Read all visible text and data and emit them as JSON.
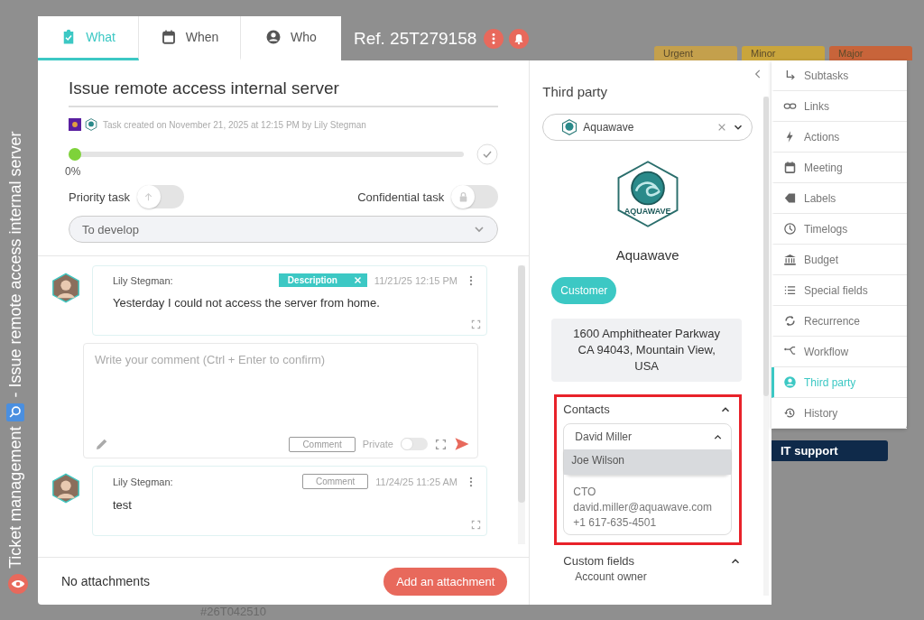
{
  "background": {
    "vertical_title": [
      "Ticket management",
      "- Issue remote access internal server"
    ],
    "priority_tags": [
      {
        "label": "Urgent",
        "color": "#c4a04c"
      },
      {
        "label": "Minor",
        "color": "#c9a53c"
      },
      {
        "label": "Major",
        "color": "#c8643a"
      }
    ],
    "team_tag": "IT support",
    "ref_below": "#26T042510"
  },
  "tabs": [
    {
      "label": "What",
      "selected": true
    },
    {
      "label": "When",
      "selected": false
    },
    {
      "label": "Who",
      "selected": false
    }
  ],
  "reference": "Ref. 25T279158",
  "task": {
    "title": "Issue remote access internal server",
    "meta": "Task created on November 21, 2025 at 12:15 PM by Lily Stegman",
    "progress": {
      "level": 0,
      "reading": "0%"
    },
    "toggles": [
      {
        "label": "Priority task",
        "on": false
      },
      {
        "label": "Confidential task",
        "on": false
      }
    ],
    "status": "To develop"
  },
  "comments": [
    {
      "kind": "description",
      "author": "Lily Stegman:",
      "tag": "Description",
      "time": "11/21/25 12:15 PM",
      "text": "Yesterday I could not access the server from home."
    },
    {
      "kind": "comment",
      "author": "Lily Stegman:",
      "tag": "Comment",
      "time": "11/24/25 11:25 AM",
      "text": "test"
    }
  ],
  "composer": {
    "placeholder": "Write your comment (Ctrl + Enter to confirm)",
    "type_label": "Comment",
    "private_label": "Private",
    "private": false
  },
  "footer": {
    "attachments": "No attachments",
    "button": "Add an attachment"
  },
  "third_party": {
    "heading": "Third party",
    "selected": "Aquawave",
    "logo_text": "AQUAWAVE",
    "name": "Aquawave",
    "type": "Customer",
    "address": [
      "1600 Amphitheater Parkway",
      "CA 94043, Mountain View,",
      "USA"
    ],
    "contacts": {
      "heading": "Contacts",
      "expanded": true,
      "field_value": "David Miller",
      "dropdown_open": true,
      "options": [
        {
          "label": "Joe Wilson",
          "selected": true
        }
      ],
      "card": [
        "CTO",
        "david.miller@aquawave.com",
        "+1 617-635-4501"
      ]
    },
    "custom_fields": {
      "heading": "Custom fields",
      "expanded": true,
      "first_label": "Account owner"
    }
  },
  "side_menu": [
    {
      "label": "Subtasks",
      "selected": false
    },
    {
      "label": "Links",
      "selected": false
    },
    {
      "label": "Actions",
      "selected": false
    },
    {
      "label": "Meeting",
      "selected": false
    },
    {
      "label": "Labels",
      "selected": false
    },
    {
      "label": "Timelogs",
      "selected": false
    },
    {
      "label": "Budget",
      "selected": false
    },
    {
      "label": "Special fields",
      "selected": false
    },
    {
      "label": "Recurrence",
      "selected": false
    },
    {
      "label": "Workflow",
      "selected": false
    },
    {
      "label": "Third party",
      "selected": true
    },
    {
      "label": "History",
      "selected": false
    }
  ]
}
